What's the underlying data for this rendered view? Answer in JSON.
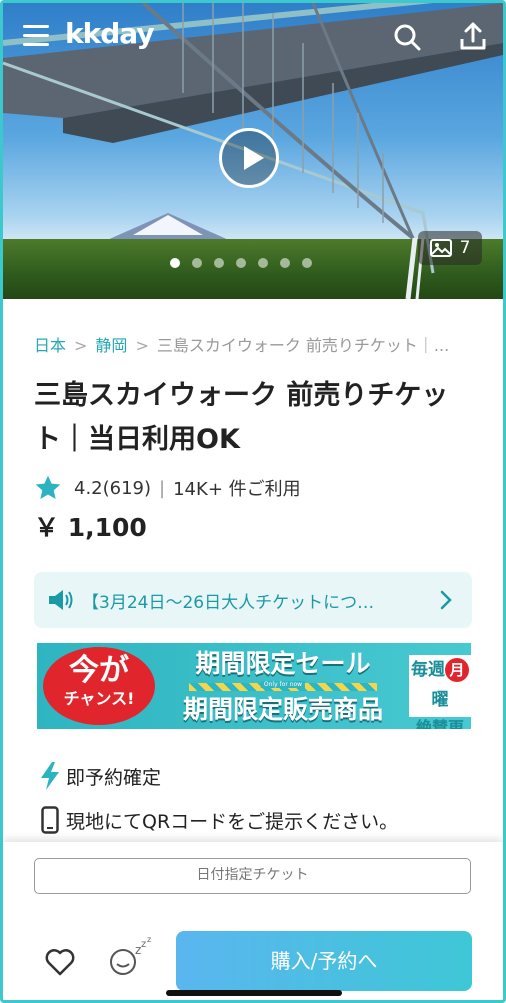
{
  "app": {
    "logo": "kkday",
    "photo_count": "7"
  },
  "carousel": {
    "total_dots": 7,
    "active_index": 0
  },
  "breadcrumb": {
    "items": [
      "日本",
      "静岡",
      "三島スカイウォーク 前売りチケット｜..."
    ]
  },
  "product": {
    "title": "三島スカイウォーク 前売りチケット｜当日利用OK",
    "rating": "4.2(619)",
    "usage": "14K+ 件ご利用",
    "price": "￥ 1,100"
  },
  "notice": {
    "text": "【3月24日〜26日大人チケットにつ…"
  },
  "banner": {
    "burst_line1": "今が",
    "burst_line2": "チャンス!",
    "mid_line1": "期間限定セール",
    "mid_small": "Only for now",
    "mid_line2": "期間限定販売商品",
    "right_line1a": "毎週",
    "right_line1b": "月",
    "right_line1c": "曜",
    "right_line2": "絶賛更新中"
  },
  "features": [
    {
      "icon": "lightning-icon",
      "label": "即予約確定"
    },
    {
      "icon": "phone-icon",
      "label": "現地にてQRコードをご提示ください。"
    }
  ],
  "bottom": {
    "date_button": "日付指定チケット",
    "book_button": "購入/予約へ"
  },
  "colors": {
    "accent": "#26a9b3",
    "book_button_start": "#5ab6ef",
    "book_button_end": "#3ec7d6",
    "banner_red": "#e0262c"
  }
}
